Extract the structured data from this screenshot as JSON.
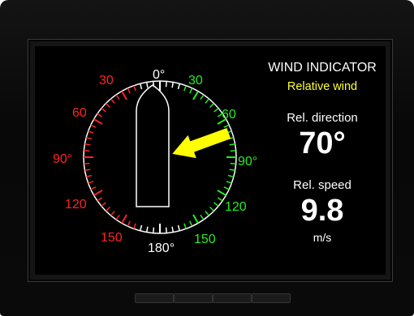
{
  "title": "WIND INDICATOR",
  "mode": "Relative wind",
  "direction": {
    "label": "Rel. direction",
    "value": "70°",
    "angle_deg": 70
  },
  "speed": {
    "label": "Rel. speed",
    "value": "9.8",
    "unit": "m/s"
  },
  "dial": {
    "labels_port": [
      "30",
      "60",
      "90°",
      "120",
      "150"
    ],
    "labels_starboard": [
      "30",
      "60",
      "90°",
      "120",
      "150"
    ],
    "label_bow": "0°",
    "label_stern": "180°",
    "colors": {
      "port": "#ff2222",
      "starboard": "#22ee22",
      "arrow": "#ffff00",
      "neutral": "#ffffff"
    }
  },
  "hardware_buttons": [
    "",
    "",
    "",
    ""
  ]
}
